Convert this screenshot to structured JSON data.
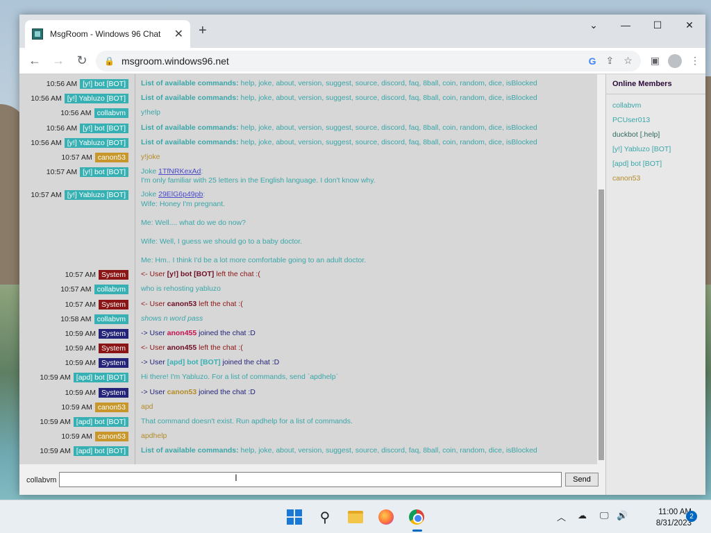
{
  "browser": {
    "tab_title": "MsgRoom - Windows 96 Chat",
    "url": "msgroom.windows96.net",
    "new_tab": "+",
    "tab_close": "✕"
  },
  "chat": {
    "messages": [
      {
        "time": "10:56 AM",
        "user": "[y!] bot [BOT]",
        "user_style": "bot",
        "lines": [
          {
            "type": "cmdlist",
            "label": "List of available commands:",
            "text": " help, joke, about, version, suggest, source, discord, faq, 8ball, coin, random, dice, isBlocked"
          }
        ]
      },
      {
        "time": "10:56 AM",
        "user": "[y!] Yabluzo [BOT]",
        "user_style": "bot",
        "lines": [
          {
            "type": "cmdlist",
            "label": "List of available commands:",
            "text": " help, joke, about, version, suggest, source, discord, faq, 8ball, coin, random, dice, isBlocked"
          }
        ]
      },
      {
        "time": "10:56 AM",
        "user": "collabvm",
        "user_style": "collab",
        "lines": [
          {
            "type": "plain",
            "text": "y!help"
          }
        ]
      },
      {
        "time": "10:56 AM",
        "user": "[y!] bot [BOT]",
        "user_style": "bot",
        "lines": [
          {
            "type": "cmdlist",
            "label": "List of available commands:",
            "text": " help, joke, about, version, suggest, source, discord, faq, 8ball, coin, random, dice, isBlocked"
          }
        ]
      },
      {
        "time": "10:56 AM",
        "user": "[y!] Yabluzo [BOT]",
        "user_style": "bot",
        "lines": [
          {
            "type": "cmdlist",
            "label": "List of available commands:",
            "text": " help, joke, about, version, suggest, source, discord, faq, 8ball, coin, random, dice, isBlocked"
          }
        ]
      },
      {
        "time": "10:57 AM",
        "user": "canon53",
        "user_style": "canon",
        "lines": [
          {
            "type": "canon",
            "text": "y!joke"
          }
        ]
      },
      {
        "time": "10:57 AM",
        "user": "[y!] bot [BOT]",
        "user_style": "bot",
        "lines": [
          {
            "type": "joke",
            "label": "Joke ",
            "link": "1TfNRKexAd",
            "text": ":"
          },
          {
            "type": "plain",
            "text": "I'm only familiar with 25 letters in the English language. I don't know why."
          }
        ]
      },
      {
        "time": "10:57 AM",
        "user": "[y!] Yabluzo [BOT]",
        "user_style": "bot",
        "lines": [
          {
            "type": "joke",
            "label": "Joke ",
            "link": "29ElG6p49pb",
            "text": ":"
          },
          {
            "type": "plain",
            "text": "Wife: Honey I'm pregnant."
          },
          {
            "type": "plain",
            "text": ""
          },
          {
            "type": "plain",
            "text": "Me: Well.... what do we do now?"
          },
          {
            "type": "plain",
            "text": ""
          },
          {
            "type": "plain",
            "text": "Wife: Well, I guess we should go to a baby doctor."
          },
          {
            "type": "plain",
            "text": ""
          },
          {
            "type": "plain",
            "text": "Me: Hm.. I think I'd be a lot more comfortable going to an adult doctor."
          }
        ]
      },
      {
        "time": "10:57 AM",
        "user": "System",
        "user_style": "sys-red",
        "lines": [
          {
            "type": "sys",
            "dir": "<- User ",
            "name": "[y!] bot [BOT]",
            "name_style": "maroon",
            "text": " left the chat :("
          }
        ]
      },
      {
        "time": "10:57 AM",
        "user": "collabvm",
        "user_style": "collab",
        "lines": [
          {
            "type": "plain",
            "text": "who is rehosting yabluzo"
          }
        ]
      },
      {
        "time": "10:57 AM",
        "user": "System",
        "user_style": "sys-red",
        "lines": [
          {
            "type": "sys",
            "dir": "<- User ",
            "name": "canon53",
            "name_style": "maroon",
            "text": " left the chat :("
          }
        ]
      },
      {
        "time": "10:58 AM",
        "user": "collabvm",
        "user_style": "collab",
        "lines": [
          {
            "type": "italic",
            "text": "shows n word pass"
          }
        ]
      },
      {
        "time": "10:59 AM",
        "user": "System",
        "user_style": "sys-blue",
        "lines": [
          {
            "type": "sys",
            "dir": "-> User ",
            "name": "anon455",
            "name_style": "red",
            "text": " joined the chat :D"
          }
        ]
      },
      {
        "time": "10:59 AM",
        "user": "System",
        "user_style": "sys-red",
        "lines": [
          {
            "type": "sys",
            "dir": "<- User ",
            "name": "anon455",
            "name_style": "maroon",
            "text": " left the chat :("
          }
        ]
      },
      {
        "time": "10:59 AM",
        "user": "System",
        "user_style": "sys-blue",
        "lines": [
          {
            "type": "sys",
            "dir": "-> User ",
            "name": "[apd] bot [BOT]",
            "name_style": "teal",
            "text": " joined the chat :D"
          }
        ]
      },
      {
        "time": "10:59 AM",
        "user": "[apd] bot [BOT]",
        "user_style": "bot",
        "lines": [
          {
            "type": "plain",
            "text": "Hi there! I'm Yabluzo. For a list of commands, send `apdhelp`"
          }
        ]
      },
      {
        "time": "10:59 AM",
        "user": "System",
        "user_style": "sys-blue",
        "lines": [
          {
            "type": "sys",
            "dir": "-> User ",
            "name": "canon53",
            "name_style": "canon",
            "text": " joined the chat :D"
          }
        ]
      },
      {
        "time": "10:59 AM",
        "user": "canon53",
        "user_style": "canon",
        "lines": [
          {
            "type": "canon",
            "text": "apd"
          }
        ]
      },
      {
        "time": "10:59 AM",
        "user": "[apd] bot [BOT]",
        "user_style": "bot",
        "lines": [
          {
            "type": "plain",
            "text": "That command doesn't exist. Run apdhelp for a list of commands."
          }
        ]
      },
      {
        "time": "10:59 AM",
        "user": "canon53",
        "user_style": "canon",
        "lines": [
          {
            "type": "canon",
            "text": "apdhelp"
          }
        ]
      },
      {
        "time": "10:59 AM",
        "user": "[apd] bot [BOT]",
        "user_style": "bot",
        "lines": [
          {
            "type": "cmdlist",
            "label": "List of available commands:",
            "text": " help, joke, about, version, suggest, source, discord, faq, 8ball, coin, random, dice, isBlocked"
          }
        ]
      }
    ]
  },
  "input": {
    "nickname": "collabvm",
    "value": "",
    "send_label": "Send"
  },
  "members": {
    "title": "Online Members",
    "list": [
      {
        "name": "collabvm",
        "style": "teal"
      },
      {
        "name": "PCUser013",
        "style": "teal"
      },
      {
        "name": "duckbot [.help]",
        "style": "dark"
      },
      {
        "name": "[y!] Yabluzo [BOT]",
        "style": "teal"
      },
      {
        "name": "[apd] bot [BOT]",
        "style": "teal"
      },
      {
        "name": "canon53",
        "style": "canon"
      }
    ]
  },
  "taskbar": {
    "time": "11:00 AM",
    "date": "8/31/2023",
    "notifications": "2"
  }
}
